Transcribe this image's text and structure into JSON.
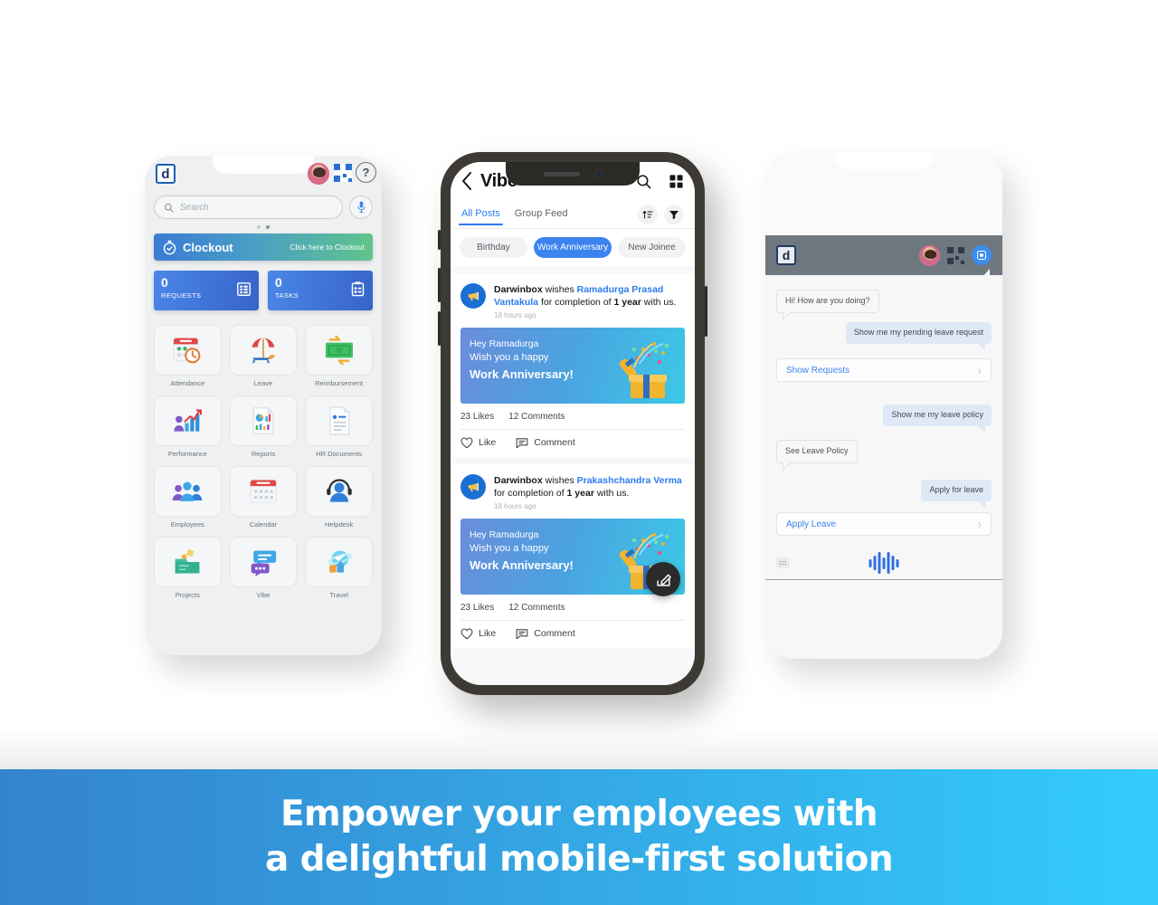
{
  "banner": {
    "line1": "Empower your employees with",
    "line2": "a delightful mobile-first solution",
    "color_start": "#3483ce",
    "color_end": "#33ccfb"
  },
  "phone_home": {
    "logo_letter": "d",
    "help_label": "?",
    "search": {
      "placeholder": "Search"
    },
    "clockout": {
      "label": "Clockout",
      "hint": "Click here to Clockout"
    },
    "tiles": [
      {
        "count": "0",
        "caption": "REQUESTS"
      },
      {
        "count": "0",
        "caption": "TASKS"
      }
    ],
    "apps": [
      {
        "label": "Attendance",
        "icon": "attendance-icon"
      },
      {
        "label": "Leave",
        "icon": "leave-icon"
      },
      {
        "label": "Reimbursement",
        "icon": "reimbursement-icon"
      },
      {
        "label": "Performance",
        "icon": "performance-icon"
      },
      {
        "label": "Reports",
        "icon": "reports-icon"
      },
      {
        "label": "HR Documents",
        "icon": "hr-documents-icon"
      },
      {
        "label": "Employees",
        "icon": "employees-icon"
      },
      {
        "label": "Calendar",
        "icon": "calendar-icon"
      },
      {
        "label": "Helpdesk",
        "icon": "helpdesk-icon"
      },
      {
        "label": "Projects",
        "icon": "projects-icon"
      },
      {
        "label": "Vibe",
        "icon": "vibe-icon"
      },
      {
        "label": "Travel",
        "icon": "travel-icon"
      }
    ]
  },
  "phone_vibe": {
    "title": "Vibe",
    "tabs": [
      {
        "label": "All Posts",
        "active": true
      },
      {
        "label": "Group Feed",
        "active": false
      }
    ],
    "chips": [
      {
        "label": "Birthday",
        "active": false
      },
      {
        "label": "Work Anniversary",
        "active": true
      },
      {
        "label": "New Joinee",
        "active": false
      }
    ],
    "posts": [
      {
        "author": "Darwinbox",
        "verb": " wishes ",
        "recipient": "Ramadurga Prasad Vantakula",
        "mid": " for completion of ",
        "duration": "1 year",
        "tail": " with us.",
        "time": "18 hours ago",
        "card_line1": "Hey Ramadurga",
        "card_line2": "Wish you a happy",
        "card_line3": "Work Anniversary!",
        "likes": "23 Likes",
        "comments": "12 Comments",
        "like_action": "Like",
        "comment_action": "Comment"
      },
      {
        "author": "Darwinbox",
        "verb": " wishes ",
        "recipient": "Prakashchandra Verma",
        "mid": " for completion of ",
        "duration": "1 year",
        "tail": " with us.",
        "time": "18 hours ago",
        "card_line1": "Hey Ramadurga",
        "card_line2": "Wish you a happy",
        "card_line3": "Work Anniversary!",
        "likes": "23 Likes",
        "comments": "12 Comments",
        "like_action": "Like",
        "comment_action": "Comment"
      }
    ]
  },
  "phone_chat": {
    "logo_letter": "d",
    "messages": [
      {
        "side": "in",
        "text": "Hi! How are you doing?"
      },
      {
        "side": "out",
        "text": "Show me my pending leave request"
      },
      {
        "side": "action",
        "text": "Show Requests"
      },
      {
        "side": "out",
        "text": "Show me my leave policy"
      },
      {
        "side": "in",
        "text": "See Leave Policy"
      },
      {
        "side": "out",
        "text": "Apply for leave"
      },
      {
        "side": "action",
        "text": "Apply Leave"
      }
    ]
  }
}
